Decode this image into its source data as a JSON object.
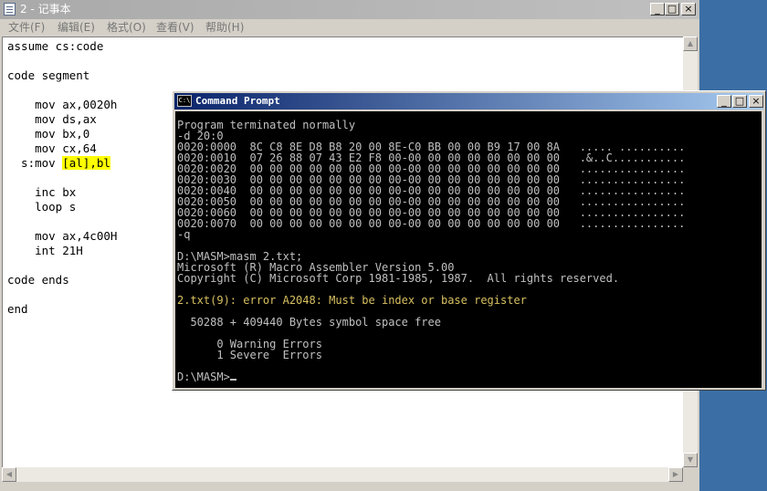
{
  "notepad": {
    "title": "2 - 记事本",
    "menu": [
      "文件(F)",
      "编辑(E)",
      "格式(O)",
      "查看(V)",
      "帮助(H)"
    ],
    "code_before": "assume cs:code\n\ncode segment\n\n    mov ax,0020h\n    mov ds,ax\n    mov bx,0\n    mov cx,64\n  s:mov ",
    "code_highlight": "[al],bl",
    "code_after": "\n\n    inc bx\n    loop s\n\n    mov ax,4c00H\n    int 21H\n\ncode ends\n\nend"
  },
  "cmd": {
    "title": "Command Prompt",
    "icon_text": "C:\\",
    "output_before": "Program terminated normally\n-d 20:0\n0020:0000  8C C8 8E D8 B8 20 00 8E-C0 BB 00 00 B9 17 00 8A   ..... ..........\n0020:0010  07 26 88 07 43 E2 F8 00-00 00 00 00 00 00 00 00   .&..C...........\n0020:0020  00 00 00 00 00 00 00 00-00 00 00 00 00 00 00 00   ................\n0020:0030  00 00 00 00 00 00 00 00-00 00 00 00 00 00 00 00   ................\n0020:0040  00 00 00 00 00 00 00 00-00 00 00 00 00 00 00 00   ................\n0020:0050  00 00 00 00 00 00 00 00-00 00 00 00 00 00 00 00   ................\n0020:0060  00 00 00 00 00 00 00 00-00 00 00 00 00 00 00 00   ................\n0020:0070  00 00 00 00 00 00 00 00-00 00 00 00 00 00 00 00   ................\n-q\n\nD:\\MASM>masm 2.txt;\nMicrosoft (R) Macro Assembler Version 5.00\nCopyright (C) Microsoft Corp 1981-1985, 1987.  All rights reserved.\n\n",
    "error_line": "2.txt(9): error A2048: Must be index or base register",
    "output_after": "\n\n  50288 + 409440 Bytes symbol space free\n\n      0 Warning Errors\n      1 Severe  Errors\n\nD:\\MASM>",
    "colors": {
      "background": "#000000",
      "text": "#c0c0c0",
      "error": "#d8c060"
    }
  },
  "window_buttons": {
    "minimize": "_",
    "maximize": "□",
    "close": "×"
  },
  "scroll_arrows": {
    "up": "▲",
    "down": "▼",
    "left": "◀",
    "right": "▶"
  }
}
